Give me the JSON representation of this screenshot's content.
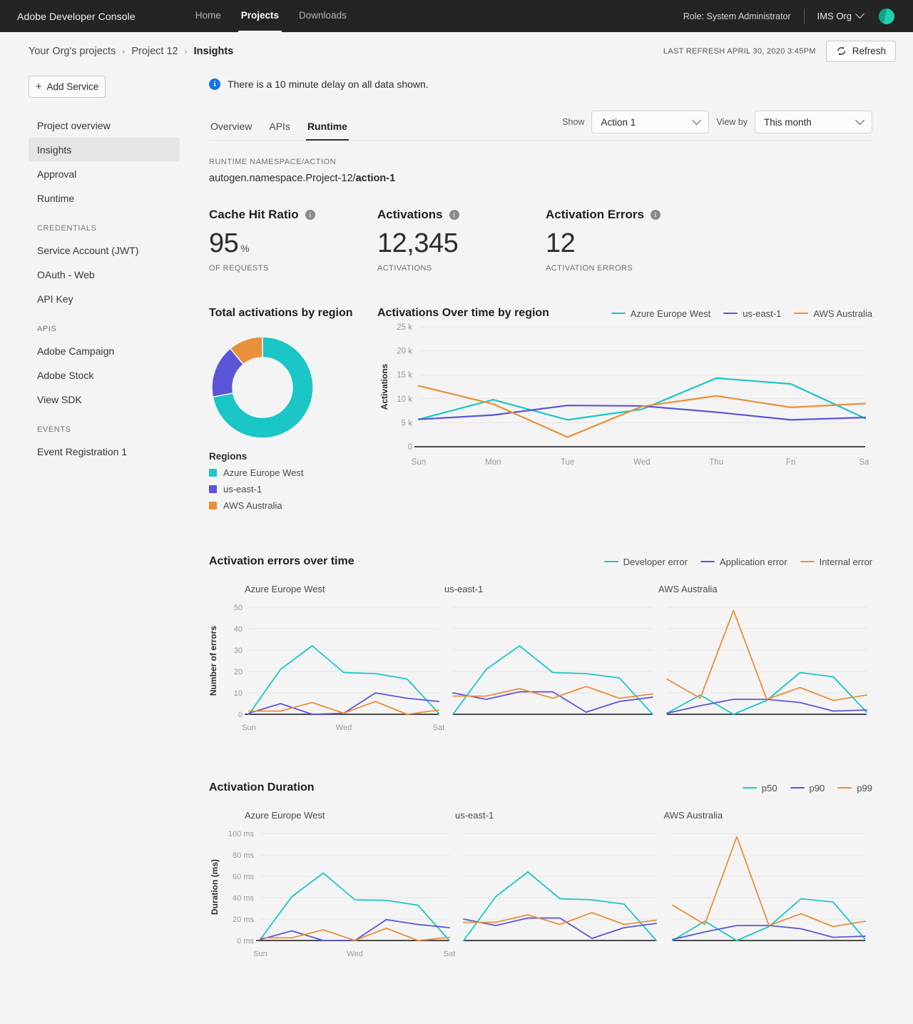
{
  "topnav": {
    "brand": "Adobe Developer Console",
    "links": [
      {
        "label": "Home",
        "active": false
      },
      {
        "label": "Projects",
        "active": true
      },
      {
        "label": "Downloads",
        "active": false
      }
    ],
    "role": "Role: System Administrator",
    "org": "IMS Org",
    "avatar_icon": "user-avatar"
  },
  "breadcrumb": {
    "items": [
      "Your Org's projects",
      "Project 12",
      "Insights"
    ],
    "separator": "›",
    "last_refresh": "LAST REFRESH APRIL 30, 2020 3:45PM",
    "refresh_label": "Refresh",
    "refresh_icon": "refresh-icon"
  },
  "sidebar": {
    "add_service_label": "Add Service",
    "add_service_icon": "plus-icon",
    "items": [
      {
        "label": "Project overview",
        "selected": false
      },
      {
        "label": "Insights",
        "selected": true
      },
      {
        "label": "Approval",
        "selected": false
      },
      {
        "label": "Runtime",
        "selected": false
      }
    ],
    "groups": [
      {
        "title": "CREDENTIALS",
        "items": [
          "Service Account (JWT)",
          "OAuth - Web",
          "API Key"
        ]
      },
      {
        "title": "APIS",
        "items": [
          "Adobe Campaign",
          "Adobe Stock",
          "View SDK"
        ]
      },
      {
        "title": "EVENTS",
        "items": [
          "Event Registration 1"
        ]
      }
    ]
  },
  "alert": {
    "icon": "info-icon",
    "glyph": "i",
    "text": "There is a 10 minute delay on all data shown."
  },
  "tabs": {
    "items": [
      {
        "label": "Overview",
        "active": false
      },
      {
        "label": "APIs",
        "active": false
      },
      {
        "label": "Runtime",
        "active": true
      }
    ],
    "show_label": "Show",
    "show_value": "Action 1",
    "viewby_label": "View by",
    "viewby_value": "This month"
  },
  "namespace": {
    "label": "RUNTIME NAMESPACE/ACTION",
    "prefix": "autogen.namespace.Project-12/",
    "action": "action-1"
  },
  "kpis": [
    {
      "title": "Cache Hit Ratio",
      "value": "95",
      "unit": "%",
      "sub": "OF REQUESTS",
      "info_icon": "info-icon"
    },
    {
      "title": "Activations",
      "value": "12,345",
      "unit": "",
      "sub": "ACTIVATIONS",
      "info_icon": "info-icon"
    },
    {
      "title": "Activation Errors",
      "value": "12",
      "unit": "",
      "sub": "ACTIVATION ERRORS",
      "info_icon": "info-icon"
    }
  ],
  "colors": {
    "teal": "#1ac6c6",
    "purple": "#5d55d8",
    "orange": "#e8903a",
    "grid": "#e4e4e4",
    "axis": "#4b4b4b",
    "tick": "#9a9a9a"
  },
  "regions_legend_title": "Regions",
  "chart_data": [
    {
      "id": "total-activations-by-region",
      "type": "pie",
      "title": "Total activations by region",
      "labels": [
        "Azure Europe West",
        "us-east-1",
        "AWS Australia"
      ],
      "values": [
        72,
        17,
        11
      ],
      "colors": [
        "#1ac6c6",
        "#5d55d8",
        "#e8903a"
      ],
      "donut": true,
      "legend": "bottom"
    },
    {
      "id": "activations-over-time-by-region",
      "type": "line",
      "title": "Activations Over time by region",
      "xlabel": "",
      "ylabel": "Activations",
      "categories": [
        "Sun",
        "Mon",
        "Tue",
        "Wed",
        "Thu",
        "Fri",
        "Sat"
      ],
      "ytick_labels": [
        "0",
        "5 k",
        "10 k",
        "15 k",
        "20 k",
        "25 k"
      ],
      "ytick_values": [
        0,
        5000,
        10000,
        15000,
        20000,
        25000
      ],
      "ylim": [
        0,
        25000
      ],
      "grid": true,
      "legend": "top-right",
      "series": [
        {
          "name": "Azure Europe West",
          "color": "#1ac6c6",
          "values": [
            5700,
            9800,
            5600,
            7800,
            14300,
            13100,
            5900
          ]
        },
        {
          "name": "us-east-1",
          "color": "#5d55d8",
          "values": [
            5700,
            6600,
            8600,
            8500,
            7200,
            5600,
            6100
          ]
        },
        {
          "name": "AWS Australia",
          "color": "#e8903a",
          "values": [
            12700,
            8900,
            2000,
            8400,
            10600,
            8200,
            9000
          ]
        }
      ]
    },
    {
      "id": "activation-errors-over-time",
      "type": "line",
      "title": "Activation errors over time",
      "ylabel": "Number of errors",
      "categories": [
        "Sun",
        "Mon",
        "Tue",
        "Wed",
        "Thu",
        "Fri",
        "Sat"
      ],
      "xtick_labels": [
        "Sun",
        "Wed",
        "Sat"
      ],
      "ytick_labels": [
        "0",
        "10",
        "20",
        "30",
        "40",
        "50"
      ],
      "ytick_values": [
        0,
        10,
        20,
        30,
        40,
        50
      ],
      "ylim": [
        0,
        50
      ],
      "grid": true,
      "legend": "top-right",
      "legend_entries": [
        "Developer error",
        "Application error",
        "Internal error"
      ],
      "panels": [
        {
          "title": "Azure Europe West",
          "series": [
            {
              "name": "Developer error",
              "color": "#1ac6c6",
              "values": [
                0,
                21,
                32,
                19.5,
                19,
                16.5,
                0.5
              ]
            },
            {
              "name": "Application error",
              "color": "#5d55d8",
              "values": [
                0.5,
                5,
                0,
                0.5,
                10,
                7.5,
                6
              ]
            },
            {
              "name": "Internal error",
              "color": "#e8903a",
              "values": [
                1.5,
                1.5,
                5.5,
                0.5,
                6,
                0,
                2
              ]
            }
          ]
        },
        {
          "title": "us-east-1",
          "series": [
            {
              "name": "Developer error",
              "color": "#1ac6c6",
              "values": [
                0,
                21,
                32,
                19.5,
                19,
                17,
                0
              ]
            },
            {
              "name": "Application error",
              "color": "#5d55d8",
              "values": [
                10,
                7,
                10.5,
                10.5,
                1,
                6,
                8
              ]
            },
            {
              "name": "Internal error",
              "color": "#e8903a",
              "values": [
                8.5,
                8.5,
                12,
                7.5,
                13,
                7.5,
                9.5
              ]
            }
          ]
        },
        {
          "title": "AWS Australia",
          "series": [
            {
              "name": "Developer error",
              "color": "#1ac6c6",
              "values": [
                0.5,
                9,
                0,
                6.5,
                19.5,
                17.5,
                1
              ]
            },
            {
              "name": "Application error",
              "color": "#5d55d8",
              "values": [
                0.5,
                4,
                7,
                7,
                5.5,
                1.5,
                2
              ]
            },
            {
              "name": "Internal error",
              "color": "#e8903a",
              "values": [
                16.5,
                7.5,
                48.5,
                7,
                12.5,
                6.5,
                9
              ]
            }
          ]
        }
      ]
    },
    {
      "id": "activation-duration",
      "type": "line",
      "title": "Activation Duration",
      "ylabel": "Duration (ms)",
      "categories": [
        "Sun",
        "Mon",
        "Tue",
        "Wed",
        "Thu",
        "Fri",
        "Sat"
      ],
      "xtick_labels": [
        "Sun",
        "Wed",
        "Sat"
      ],
      "ytick_labels": [
        "0 ms",
        "20 ms",
        "40 ms",
        "60 ms",
        "80 ms",
        "100 ms"
      ],
      "ytick_values": [
        0,
        20,
        40,
        60,
        80,
        100
      ],
      "ylim": [
        0,
        100
      ],
      "grid": true,
      "legend": "top-right",
      "legend_entries": [
        "p50",
        "p90",
        "p99"
      ],
      "panels": [
        {
          "title": "Azure Europe West",
          "series": [
            {
              "name": "p50",
              "color": "#1ac6c6",
              "values": [
                1,
                41,
                63,
                38,
                37.5,
                33,
                0
              ]
            },
            {
              "name": "p90",
              "color": "#5d55d8",
              "values": [
                1,
                9,
                0,
                0,
                19.5,
                15,
                12
              ]
            },
            {
              "name": "p99",
              "color": "#e8903a",
              "values": [
                2.5,
                2.5,
                10,
                0,
                11.5,
                0,
                3
              ]
            }
          ]
        },
        {
          "title": "us-east-1",
          "series": [
            {
              "name": "p50",
              "color": "#1ac6c6",
              "values": [
                0,
                41,
                64,
                39,
                38,
                34,
                0
              ]
            },
            {
              "name": "p90",
              "color": "#5d55d8",
              "values": [
                20,
                14,
                21,
                21,
                2,
                12,
                16
              ]
            },
            {
              "name": "p99",
              "color": "#e8903a",
              "values": [
                17,
                17,
                24,
                15,
                26,
                15,
                19
              ]
            }
          ]
        },
        {
          "title": "AWS Australia",
          "series": [
            {
              "name": "p50",
              "color": "#1ac6c6",
              "values": [
                0,
                18,
                0,
                13,
                39,
                36,
                1
              ]
            },
            {
              "name": "p90",
              "color": "#5d55d8",
              "values": [
                1,
                8,
                14,
                14,
                11,
                3,
                4
              ]
            },
            {
              "name": "p99",
              "color": "#e8903a",
              "values": [
                33,
                15,
                97,
                14,
                25,
                13,
                18
              ]
            }
          ]
        }
      ]
    }
  ]
}
